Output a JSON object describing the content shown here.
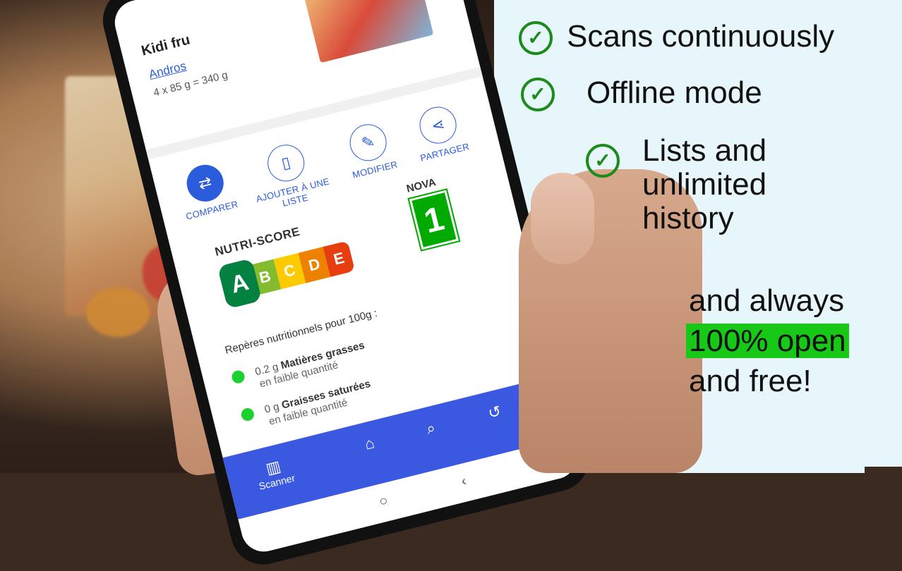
{
  "features": [
    {
      "text": "Scans continuously"
    },
    {
      "text": "Offline mode"
    },
    {
      "text": "Lists and unlimited history",
      "lines": [
        "Lists and",
        "unlimited",
        "history"
      ]
    }
  ],
  "tagline": {
    "line1": "and always",
    "highlight": "100% open",
    "line3": "and free!"
  },
  "colors": {
    "check": "#1e8a1e",
    "highlight": "#17c817",
    "app_blue": "#3a58e0",
    "nova_green": "#00aa00"
  },
  "phone": {
    "product_name": "Kidi fru",
    "brand": "Andros",
    "quantity": "4 x 85 g = 340 g",
    "actions": [
      {
        "label": "COMPARER",
        "icon": "compare-icon"
      },
      {
        "label": "AJOUTER À UNE LISTE",
        "icon": "bookmark-icon"
      },
      {
        "label": "MODIFIER",
        "icon": "pencil-icon"
      },
      {
        "label": "PARTAGER",
        "icon": "share-icon"
      }
    ],
    "nutriscore": {
      "title": "NUTRI-SCORE",
      "grades": [
        "A",
        "B",
        "C",
        "D",
        "E"
      ],
      "selected": "A"
    },
    "nova": {
      "title": "NOVA",
      "value": "1"
    },
    "nutrients_heading": "Repères nutritionnels pour 100g :",
    "nutrients": [
      {
        "amount": "0.2 g",
        "name": "Matières grasses",
        "level": "en faible quantité"
      },
      {
        "amount": "0 g",
        "name": "Graisses saturées",
        "level": "en faible quantité"
      }
    ],
    "bottom_nav": {
      "scanner_label": "Scanner"
    }
  }
}
